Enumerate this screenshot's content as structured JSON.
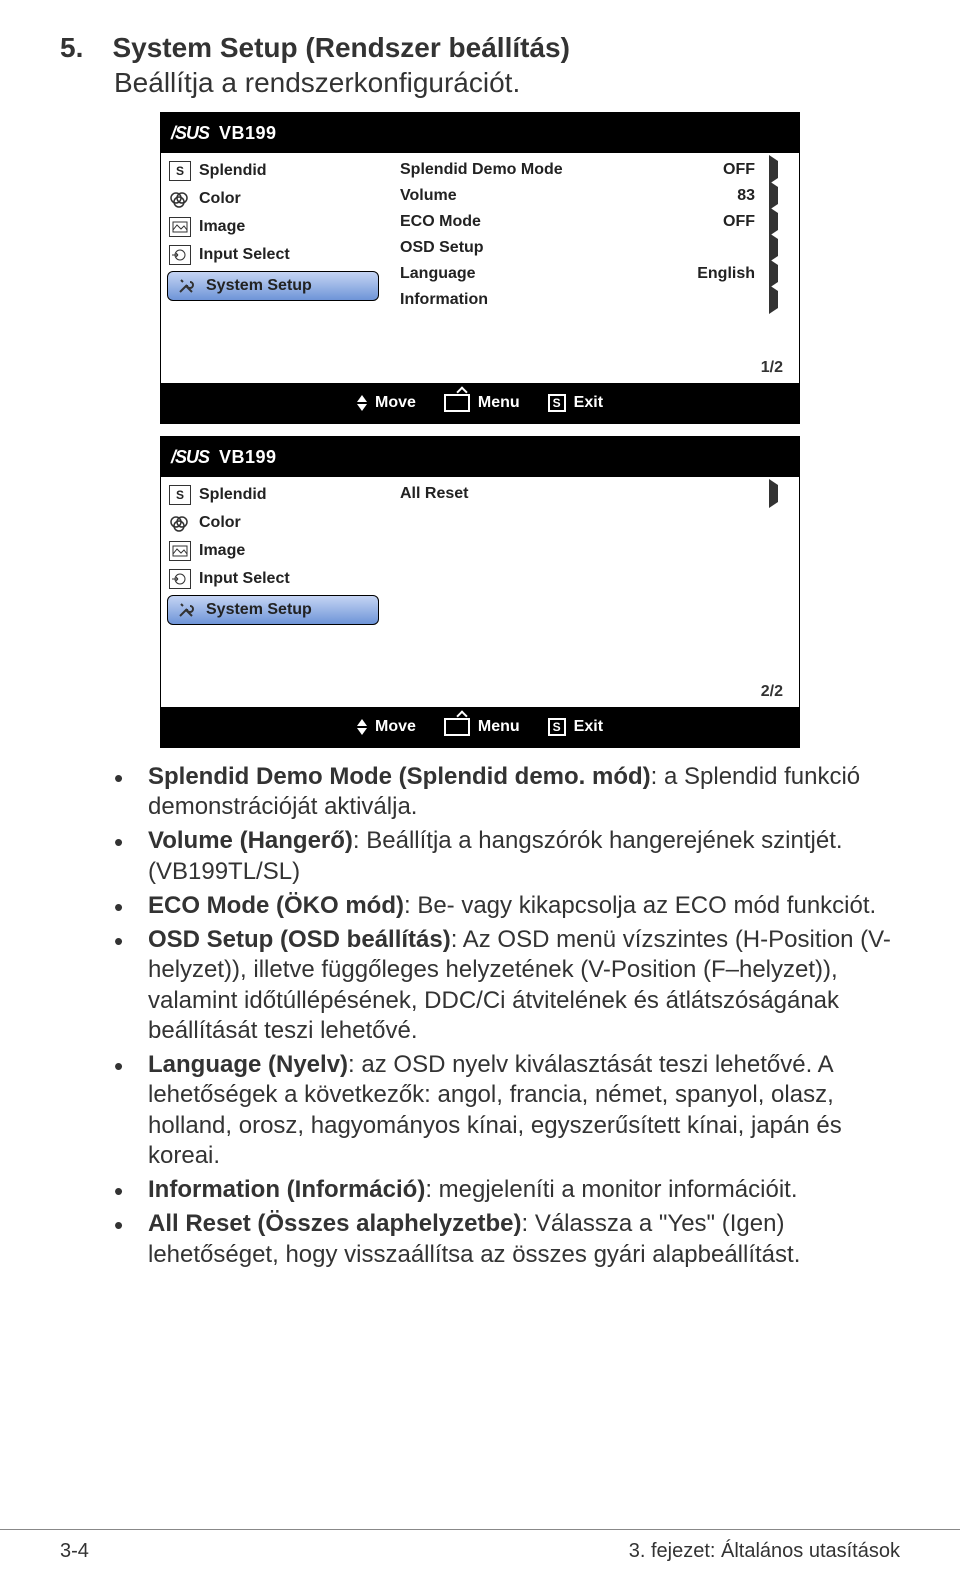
{
  "heading": {
    "num": "5.",
    "title": "System Setup (Rendszer beállítás)",
    "subtitle": "Beállítja a rendszerkonfigurációt."
  },
  "osd": {
    "brand": "/SUS",
    "model": "VB199",
    "side": {
      "splendid": "Splendid",
      "color": "Color",
      "image": "Image",
      "input": "Input Select",
      "system": "System Setup"
    },
    "footer": {
      "move": "Move",
      "menu": "Menu",
      "exit": "Exit"
    },
    "page1": {
      "rows": {
        "splendid_demo": {
          "label": "Splendid Demo Mode",
          "value": "OFF"
        },
        "volume": {
          "label": "Volume",
          "value": "83"
        },
        "eco": {
          "label": "ECO Mode",
          "value": "OFF"
        },
        "osd_setup": {
          "label": "OSD Setup",
          "value": ""
        },
        "language": {
          "label": "Language",
          "value": "English"
        },
        "information": {
          "label": "Information",
          "value": ""
        }
      },
      "page": "1/2"
    },
    "page2": {
      "rows": {
        "all_reset": {
          "label": "All Reset",
          "value": ""
        }
      },
      "page": "2/2"
    }
  },
  "bullets": {
    "b1a": "Splendid Demo Mode (Splendid demo. mód)",
    "b1b": ": a Splendid funkció demonstrációját aktiválja.",
    "b2a": "Volume (Hangerő)",
    "b2b": ": Beállítja a hangszórók hangerejének szintjét. (VB199TL/SL)",
    "b3a": "ECO Mode (ÖKO mód)",
    "b3b": ": Be- vagy kikapcsolja az ECO mód funkciót.",
    "b4a": "OSD Setup (OSD beállítás)",
    "b4b": ": Az OSD menü vízszintes (H-Position (V-helyzet)), illetve függőleges helyzetének (V-Position (F–helyzet)), valamint időtúllépésének, DDC/Ci átvitelének és átlátszóságának beállítását teszi lehetővé.",
    "b5a": "Language (Nyelv)",
    "b5b": ": az OSD nyelv kiválasztását teszi lehetővé. A lehetőségek a következők: angol, francia, német, spanyol, olasz, holland, orosz, hagyományos kínai, egyszerűsített kínai, japán és koreai.",
    "b6a": "Information (Információ)",
    "b6b": ": megjeleníti a monitor információit.",
    "b7a": "All Reset (Összes alaphelyzetbe)",
    "b7b": ": Válassza a \"Yes\" (Igen) lehetőséget, hogy visszaállítsa az összes gyári alapbeállítást."
  },
  "footer": {
    "left": "3-4",
    "right": "3. fejezet: Általános utasítások"
  }
}
